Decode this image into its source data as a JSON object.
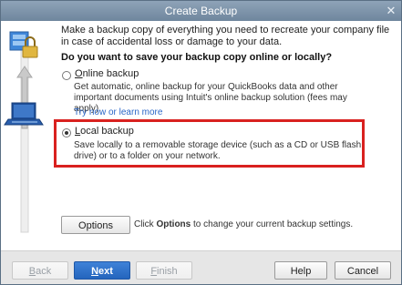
{
  "window": {
    "title": "Create Backup",
    "close_glyph": "✕"
  },
  "intro": "Make a backup copy of everything you need to recreate your company file in case of accidental loss or damage to your data.",
  "question": "Do you want to save your backup copy online or locally?",
  "online": {
    "label": "Online backup",
    "selected": false,
    "description": "Get automatic, online backup for your QuickBooks data and other important documents using Intuit's online backup solution (fees may apply).",
    "link": "Try now or learn more"
  },
  "local": {
    "label": "Local backup",
    "selected": true,
    "description": "Save locally to a removable storage device (such as a CD or USB flash drive) or to a folder on your network."
  },
  "options": {
    "button_label": "Options",
    "hint_prefix": "Click ",
    "hint_bold": "Options",
    "hint_suffix": " to change your current backup settings."
  },
  "footer": {
    "back": "Back",
    "next": "Next",
    "finish": "Finish",
    "help": "Help",
    "cancel": "Cancel"
  },
  "colors": {
    "accent": "#2465bd",
    "highlight_border": "#d9211f",
    "link": "#2a67c8"
  },
  "icons": [
    "computer-server-icon",
    "lock-icon",
    "arrow-up-icon",
    "laptop-icon",
    "radio-button-icon"
  ]
}
